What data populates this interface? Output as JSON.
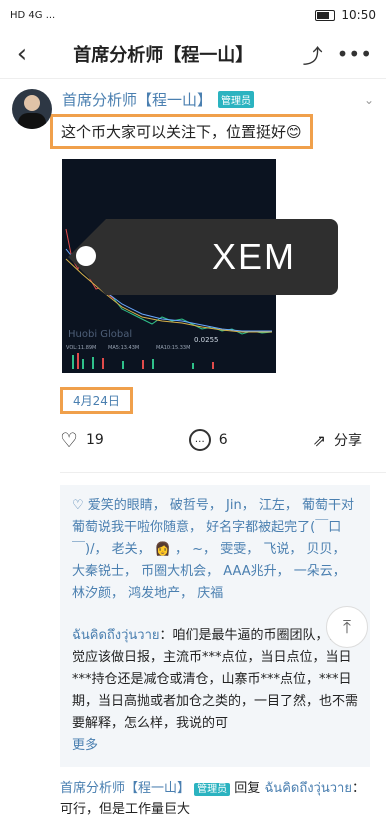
{
  "status": {
    "time": "10:50",
    "left": "HD 4G ..."
  },
  "nav": {
    "title": "首席分析师【程一山】",
    "back": "‹",
    "share": "⤴",
    "more": "•••"
  },
  "post": {
    "author": "首席分析师【程一山】",
    "badge": "管理员",
    "text": "这个币大家可以关注下，位置挺好😊",
    "date": "4月24日",
    "overlay_label": "XEM",
    "chart_labels": {
      "watermark": "Huobi Global",
      "price": "0.0255",
      "vol": "VOL:11.89M",
      "ma5": "MA5:13.43M",
      "ma10": "MA10:15.33M"
    }
  },
  "actions": {
    "likes": "19",
    "comments": "6",
    "share": "分享"
  },
  "likes_text": "爱笑的眼睛， 破哲号， Jin， 江左， 葡萄干对葡萄说我干啦你随意， 好名字都被起完了(￣口￣)/， 老关， 👩 ， ~， 雯雯， 飞说， 贝贝， 大秦锐士， 币圈大机会， AAA兆升， 一朵云， 林汐颜， 鸿发地产， 庆福",
  "comment1": {
    "user": "ฉันคิดถึงวุ่นวาย",
    "text": "：咱们是最牛逼的币圈团队，我感觉应该做日报，主流币***点位，当日点位，当日***持仓还是减仓或清仓，山寨币***点位，***日期，当日高抛或者加仓之类的，一目了然，也不需要解释，怎么样，我说的可",
    "more": "更多"
  },
  "reply": {
    "author": "首席分析师【程一山】",
    "badge": "管理员",
    "verb": "回复",
    "to": "ฉันคิดถึงวุ่นวาย",
    "text": "：可行，但是工作量巨大"
  }
}
